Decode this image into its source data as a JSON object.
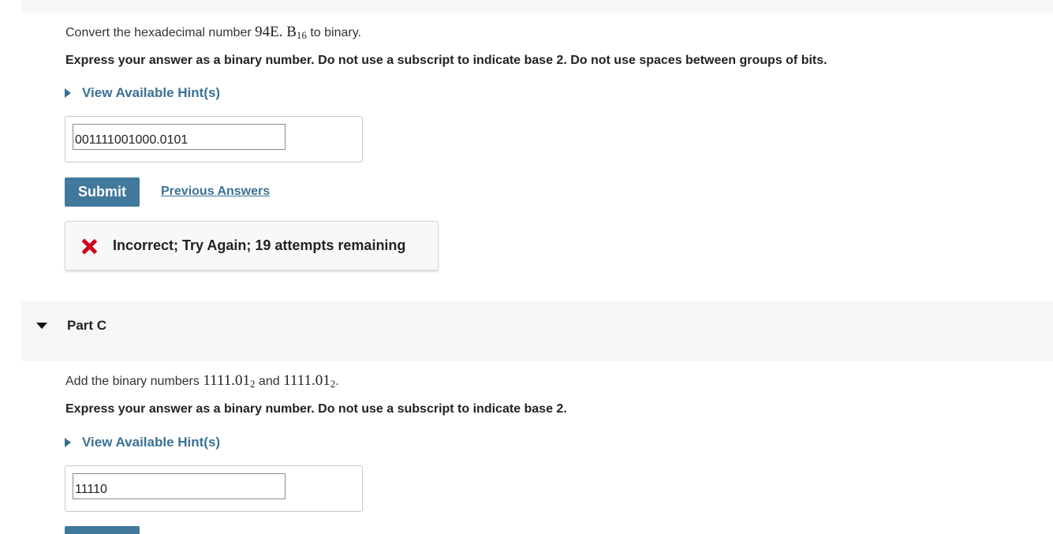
{
  "partB": {
    "prompt": {
      "pre": "Convert the hexadecimal number ",
      "number": "94E. B",
      "base": "16",
      "post": " to binary."
    },
    "instruction": "Express your answer as a binary number. Do not use a subscript to indicate base 2. Do not use spaces between groups of bits.",
    "hint_label": "View Available Hint(s)",
    "answer_value": "001111001000.0101",
    "submit_label": "Submit",
    "previous_answers_label": "Previous Answers",
    "feedback": {
      "status": "incorrect",
      "message": "Incorrect; Try Again; 19 attempts remaining",
      "icon": "x-icon",
      "icon_color": "#d0021b"
    }
  },
  "partC": {
    "header_title": "Part C",
    "expanded": true,
    "prompt": {
      "pre": "Add the binary numbers ",
      "num1": "1111.01",
      "sub1": "2",
      "mid": " and ",
      "num2": "1111.01",
      "sub2": "2",
      "post": "."
    },
    "instruction": "Express your answer as a binary number. Do not use a subscript to indicate base 2.",
    "hint_label": "View Available Hint(s)",
    "answer_value": "11110"
  },
  "colors": {
    "accent": "#41799c",
    "link": "#3b7195",
    "error": "#d0021b",
    "panel_bg": "#f6f6f6"
  }
}
